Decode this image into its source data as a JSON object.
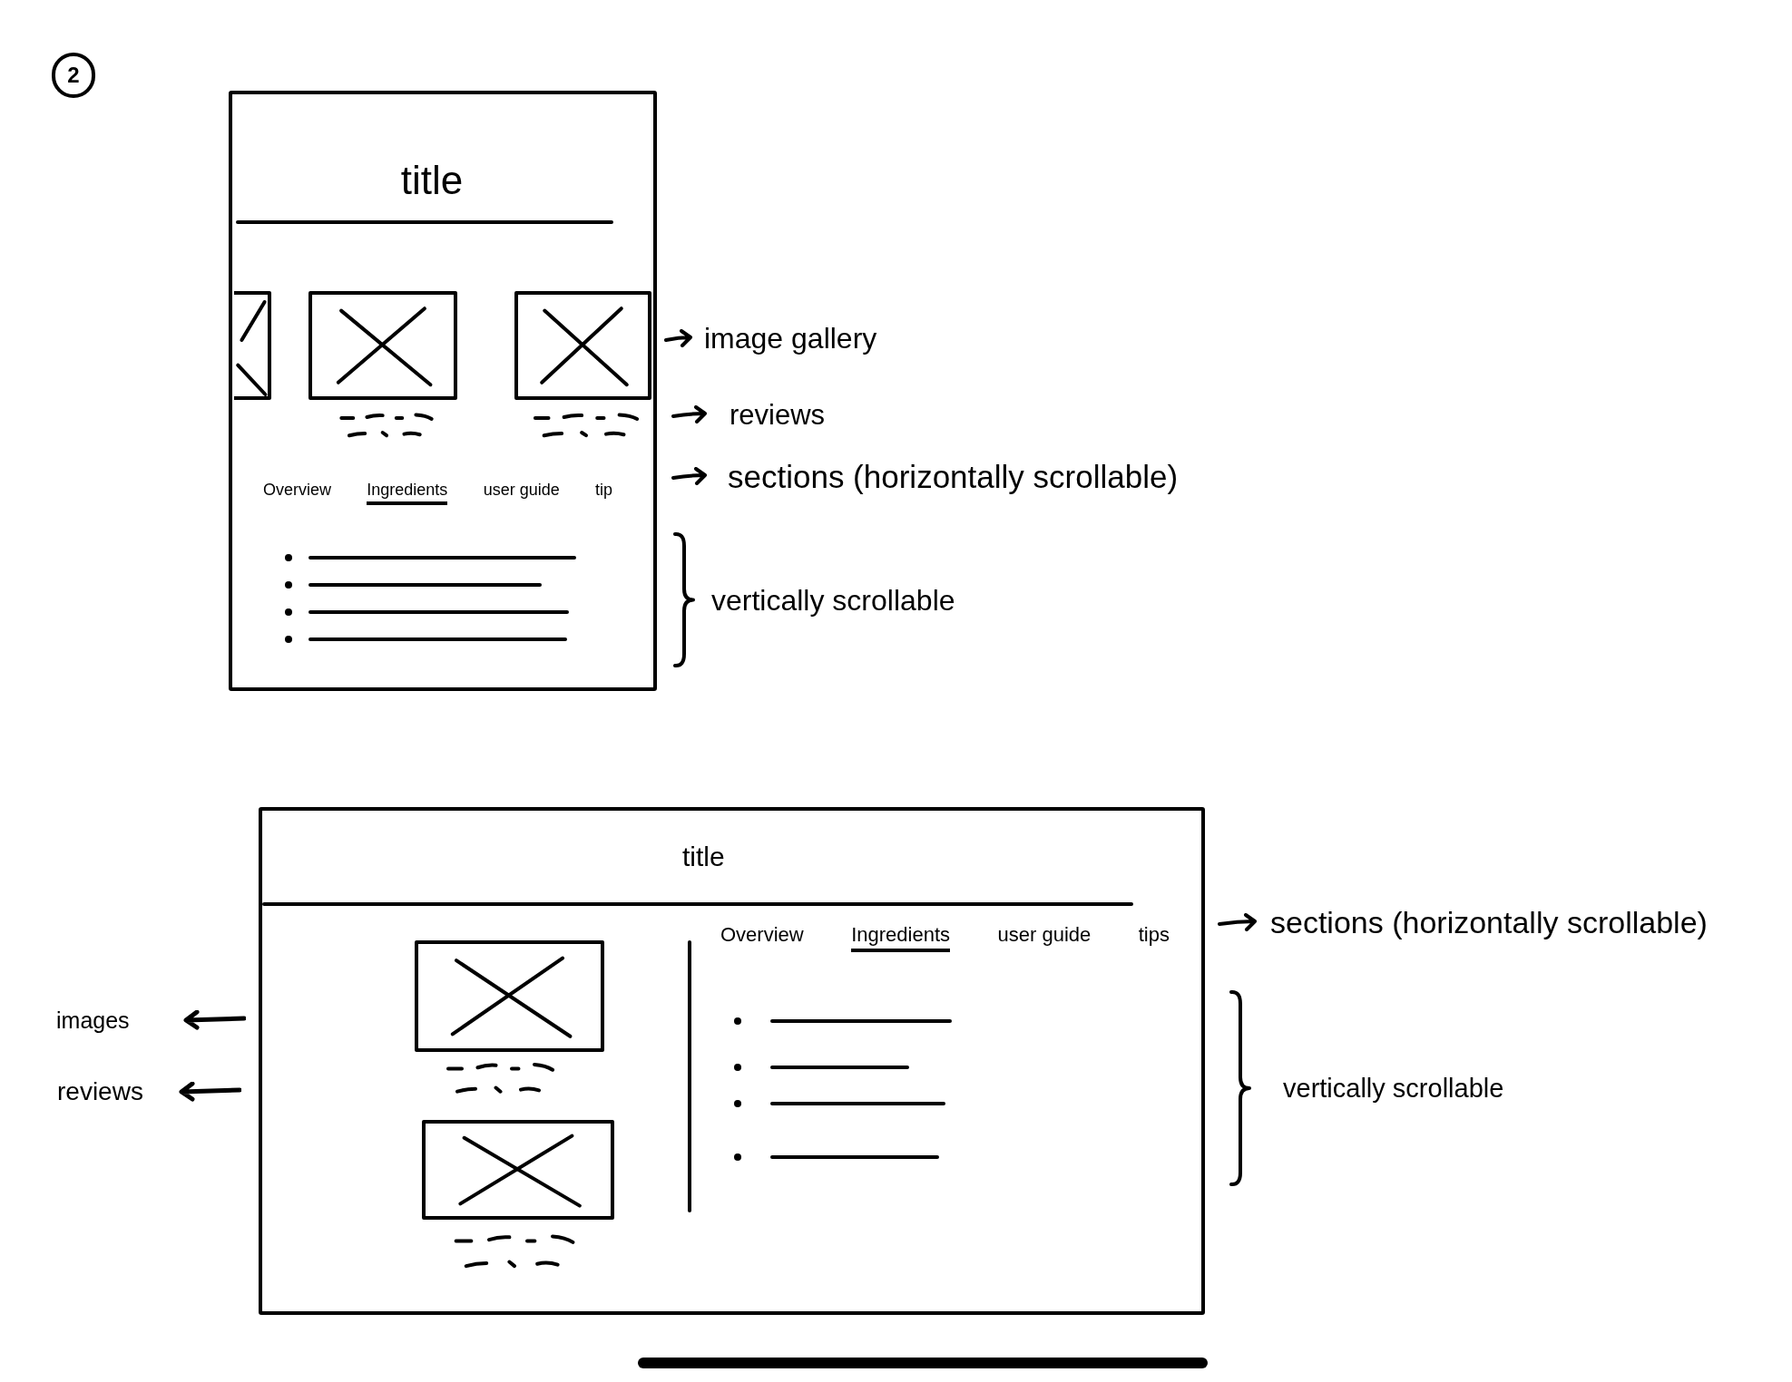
{
  "sketch_number": "2",
  "mobile_wireframe": {
    "title": "title",
    "gallery": [
      {
        "kind": "cropped_image"
      },
      {
        "kind": "image"
      },
      {
        "kind": "image"
      }
    ],
    "tabs": [
      {
        "label": "Overview",
        "selected": false
      },
      {
        "label": "Ingredients",
        "selected": true
      },
      {
        "label": "user guide",
        "selected": false
      },
      {
        "label": "tip",
        "selected": false
      }
    ],
    "content_lines": [
      {
        "kind": "bullet_line"
      },
      {
        "kind": "bullet_line"
      },
      {
        "kind": "bullet_line"
      },
      {
        "kind": "bullet_line"
      }
    ]
  },
  "mobile_notes": [
    {
      "kind": "arrow",
      "text": "image gallery"
    },
    {
      "kind": "arrow",
      "text": "reviews"
    },
    {
      "kind": "arrow",
      "text": "sections (horizontally scrollable)"
    },
    {
      "kind": "brace",
      "text": "vertically scrollable"
    }
  ],
  "tablet_wireframe": {
    "title": "title",
    "images": [
      {
        "kind": "image"
      },
      {
        "kind": "image"
      }
    ],
    "tabs": [
      {
        "label": "Overview",
        "selected": false
      },
      {
        "label": "Ingredients",
        "selected": true
      },
      {
        "label": "user guide",
        "selected": false
      },
      {
        "label": "tips",
        "selected": false
      }
    ],
    "content_lines": [
      {
        "kind": "bullet_line"
      },
      {
        "kind": "bullet_line"
      },
      {
        "kind": "bullet_line"
      },
      {
        "kind": "bullet_line"
      }
    ]
  },
  "tablet_left_notes": [
    {
      "kind": "arrow",
      "text": "images"
    },
    {
      "kind": "arrow",
      "text": "reviews"
    }
  ],
  "tablet_right_notes": [
    {
      "kind": "arrow",
      "text": "sections (horizontally scrollable)"
    },
    {
      "kind": "brace",
      "text": "vertically scrollable"
    }
  ]
}
